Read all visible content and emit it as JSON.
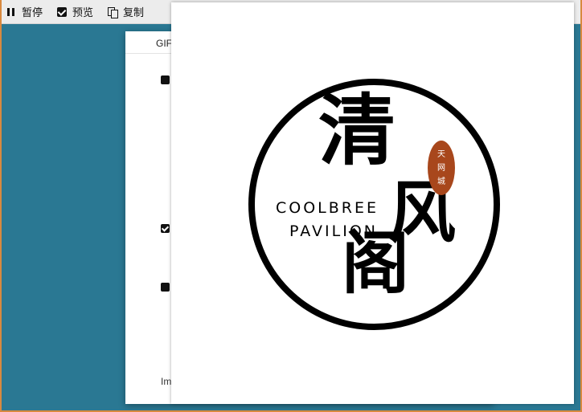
{
  "toolbar": {
    "pause_label": "暂停",
    "preview_label": "预览",
    "copy_label": "复制",
    "icons": [
      "pause-icon",
      "checkbox-checked-icon",
      "copy-icon"
    ]
  },
  "dialog": {
    "tab_label": "GIF",
    "footer_text": "Im"
  },
  "preview": {
    "logo": {
      "char_1": "清",
      "char_2": "风",
      "char_3": "阁",
      "english_line_1": "COOLBREE",
      "english_line_2": "PAVILION",
      "seal_text": "天网城",
      "colors": {
        "ink": "#000000",
        "seal": "#a8471c"
      }
    }
  },
  "colors": {
    "background": "#2a7893",
    "window_border": "#d8893f"
  }
}
